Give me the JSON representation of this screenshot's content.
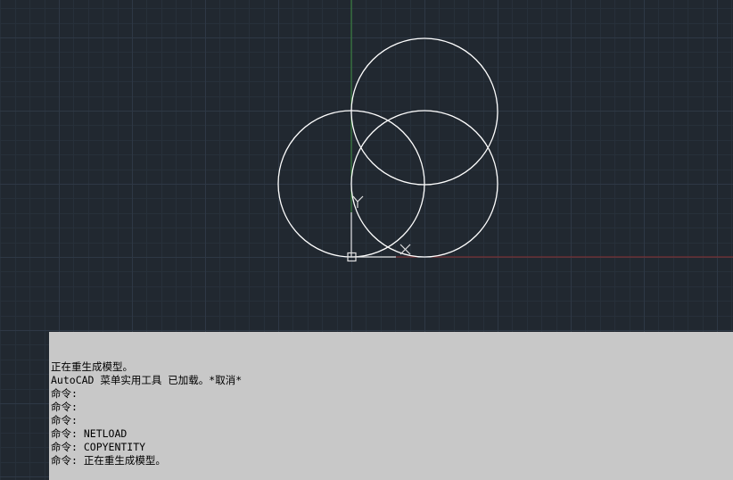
{
  "drawing": {
    "background_color": "#212830",
    "grid_minor_color": "#27303a",
    "grid_major_color": "#2e3845",
    "entity_color": "#ffffff",
    "y_axis_color": "#3a8a3a",
    "x_axis_color": "#8a2f2f",
    "ucs_icon_color": "#e0e0e0",
    "ucs_labels": {
      "x": "X",
      "y": "Y"
    }
  },
  "command_history": {
    "background_color": "#c8c8c8",
    "lines": [
      "正在重生成模型。",
      "AutoCAD 菜单实用工具 已加载。*取消*",
      "命令:",
      "命令:",
      "命令:",
      "命令: NETLOAD",
      "命令: COPYENTITY",
      "命令: 正在重生成模型。"
    ]
  }
}
